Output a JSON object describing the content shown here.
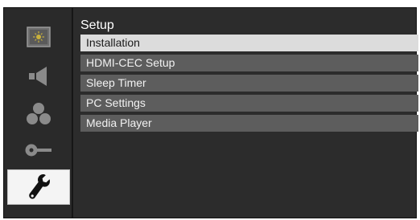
{
  "sidebar": {
    "items": [
      {
        "icon": "picture-icon",
        "active": false
      },
      {
        "icon": "speaker-icon",
        "active": false
      },
      {
        "icon": "color-circles-icon",
        "active": false
      },
      {
        "icon": "key-icon",
        "active": false
      },
      {
        "icon": "wrench-icon",
        "active": true
      }
    ]
  },
  "menu": {
    "title": "Setup",
    "items": [
      {
        "label": "Installation",
        "selected": true
      },
      {
        "label": "HDMI-CEC Setup",
        "selected": false
      },
      {
        "label": "Sleep Timer",
        "selected": false
      },
      {
        "label": "PC Settings",
        "selected": false
      },
      {
        "label": "Media Player",
        "selected": false
      }
    ]
  },
  "colors": {
    "background": "#2c2c2c",
    "item": "#5d5d5d",
    "selected_item": "#dcdcdc",
    "active_tab": "#f4f4f4"
  }
}
